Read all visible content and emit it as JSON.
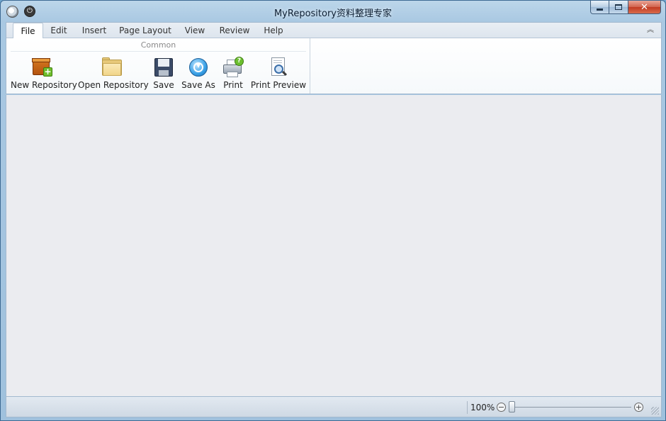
{
  "window": {
    "title": "MyRepository资料整理专家"
  },
  "ribbon": {
    "tabs": [
      {
        "label": "File",
        "active": true
      },
      {
        "label": "Edit"
      },
      {
        "label": "Insert"
      },
      {
        "label": "Page Layout"
      },
      {
        "label": "View"
      },
      {
        "label": "Review"
      },
      {
        "label": "Help"
      }
    ],
    "groups": [
      {
        "label": "Common",
        "buttons": [
          {
            "label": "New Repository",
            "icon": "new-repository-icon"
          },
          {
            "label": "Open Repository",
            "icon": "folder-icon"
          },
          {
            "label": "Save",
            "icon": "floppy-disk-icon"
          },
          {
            "label": "Save As",
            "icon": "save-as-icon"
          },
          {
            "label": "Print",
            "icon": "printer-icon"
          },
          {
            "label": "Print Preview",
            "icon": "print-preview-icon"
          }
        ]
      }
    ]
  },
  "statusbar": {
    "zoom": "100%"
  }
}
